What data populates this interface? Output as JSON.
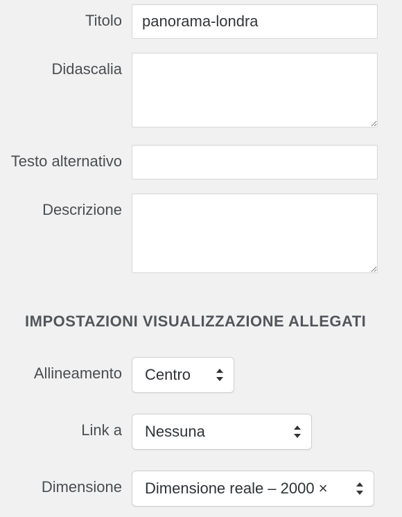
{
  "fields": {
    "title": {
      "label": "Titolo",
      "value": "panorama-londra"
    },
    "caption": {
      "label": "Didascalia",
      "value": ""
    },
    "alt": {
      "label": "Testo alternativo",
      "value": ""
    },
    "description": {
      "label": "Descrizione",
      "value": ""
    }
  },
  "settings": {
    "heading": "IMPOSTAZIONI VISUALIZZAZIONE ALLEGATI",
    "align": {
      "label": "Allineamento",
      "value": "Centro"
    },
    "linkto": {
      "label": "Link a",
      "value": "Nessuna"
    },
    "size": {
      "label": "Dimensione",
      "value": "Dimensione reale – 2000 ×"
    }
  }
}
